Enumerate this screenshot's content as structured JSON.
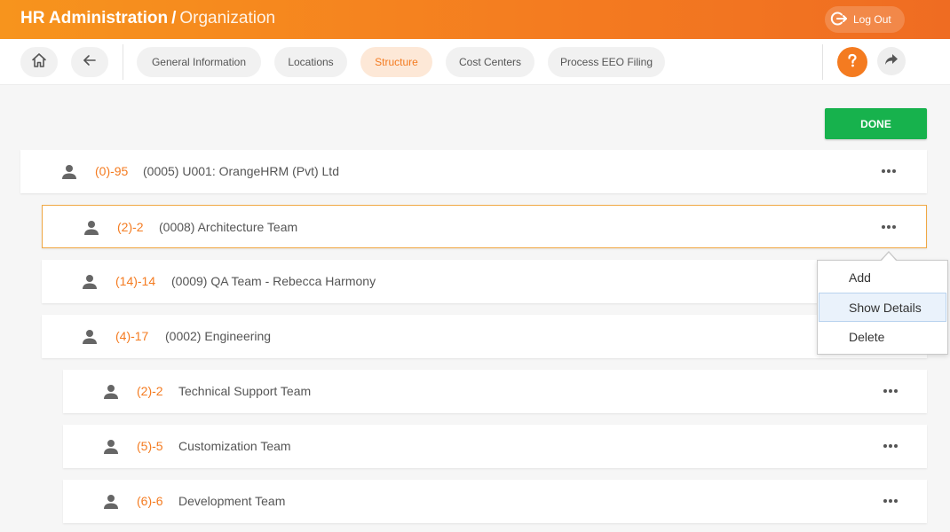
{
  "header": {
    "title": "HR Administration",
    "separator": "/",
    "subtitle": "Organization",
    "logout_label": "Log Out"
  },
  "toolbar": {
    "tabs": [
      {
        "label": "General Information"
      },
      {
        "label": "Locations"
      },
      {
        "label": "Structure"
      },
      {
        "label": "Cost Centers"
      },
      {
        "label": "Process EEO Filing"
      }
    ],
    "active_tab": "Structure"
  },
  "done_label": "DONE",
  "tree": [
    {
      "count": "(0)-95",
      "label": "(0005) U001: OrangeHRM (Pvt) Ltd",
      "level": 0
    },
    {
      "count": "(2)-2",
      "label": "(0008) Architecture Team",
      "level": 1,
      "selected": true
    },
    {
      "count": "(14)-14",
      "label": "(0009) QA Team - Rebecca Harmony",
      "level": 1
    },
    {
      "count": "(4)-17",
      "label": "(0002) Engineering",
      "level": 1
    },
    {
      "count": "(2)-2",
      "label": "Technical Support Team",
      "level": 2
    },
    {
      "count": "(5)-5",
      "label": "Customization Team",
      "level": 2
    },
    {
      "count": "(6)-6",
      "label": "Development Team",
      "level": 2
    }
  ],
  "context_menu": {
    "items": [
      {
        "label": "Add"
      },
      {
        "label": "Show Details",
        "highlighted": true
      },
      {
        "label": "Delete"
      }
    ]
  },
  "colors": {
    "brand_orange": "#f47b20",
    "done_green": "#17b24d",
    "selected_border": "#f0a844"
  },
  "icons": {
    "home": "home-icon",
    "back": "arrow-left-icon",
    "help": "question-icon",
    "share": "share-arrow-icon",
    "logout": "logout-icon",
    "person": "person-icon",
    "more": "more-dots-icon"
  }
}
